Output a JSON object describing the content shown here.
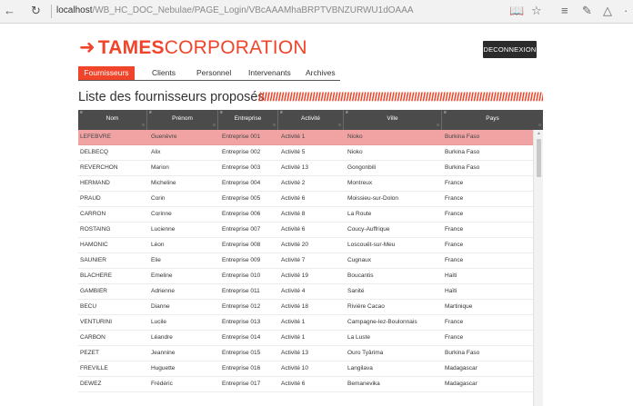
{
  "browser": {
    "back_glyph": "←",
    "refresh_glyph": "↻",
    "url_host": "localhost",
    "url_path": "/WB_HC_DOC_Nebulae/PAGE_Login/VBcAAAMhaBRPTVBNZURWU1dOAAA",
    "reading_view_glyph": "📖",
    "favorite_glyph": "☆",
    "hub_glyph": "≡",
    "note_glyph": "✎",
    "share_glyph": "△",
    "more_glyph": "·"
  },
  "header": {
    "logo_mark": "➜",
    "logo_bold": "TAMES",
    "logo_thin": "CORPORATION",
    "logout_label": "DECONNEXION"
  },
  "tabs": [
    {
      "label": "Fournisseurs",
      "active": true
    },
    {
      "label": "Clients",
      "active": false
    },
    {
      "label": "Personnel",
      "active": false
    },
    {
      "label": "Intervenants",
      "active": false
    },
    {
      "label": "Archives",
      "active": false
    }
  ],
  "page": {
    "title": "Liste des fournisseurs proposés",
    "title_decoration": "//////////////////////////////////////////////////////////////////////////////////////////////////////"
  },
  "table": {
    "columns": [
      "Nom",
      "Prénom",
      "Entreprise",
      "Activité",
      "Ville",
      "Pays"
    ],
    "header_marker": "≡",
    "sort_marker": "○",
    "selected_row": 0,
    "rows": [
      [
        "LEFEBVRE",
        "Guenèvre",
        "Entreprise 001",
        "Activité 1",
        "Nioko",
        "Burkina Faso"
      ],
      [
        "DELBECQ",
        "Alix",
        "Entreprise 002",
        "Activité 5",
        "Nioko",
        "Burkina Faso"
      ],
      [
        "REVERCHON",
        "Marion",
        "Entreprise 003",
        "Activité 13",
        "Gongonbili",
        "Burkina Faso"
      ],
      [
        "HERMAND",
        "Micheline",
        "Entreprise 004",
        "Activité 2",
        "Montreux",
        "France"
      ],
      [
        "PRAUD",
        "Corin",
        "Entreprise 005",
        "Activité 6",
        "Moissieu-sur-Dolon",
        "France"
      ],
      [
        "CARRON",
        "Corinne",
        "Entreprise 006",
        "Activité 8",
        "La Route",
        "France"
      ],
      [
        "ROSTAING",
        "Lucienne",
        "Entreprise 007",
        "Activité 6",
        "Coucy-Auffrique",
        "France"
      ],
      [
        "HAMONIC",
        "Léon",
        "Entreprise 008",
        "Activité 20",
        "Loscouët-sur-Meu",
        "France"
      ],
      [
        "SAUNIER",
        "Elie",
        "Entreprise 009",
        "Activité 7",
        "Cugnaux",
        "France"
      ],
      [
        "BLACHERE",
        "Emeline",
        "Entreprise 010",
        "Activité 19",
        "Boucantis",
        "Haïti"
      ],
      [
        "GAMBIER",
        "Adrienne",
        "Entreprise 011",
        "Activité 4",
        "Sanité",
        "Haïti"
      ],
      [
        "BECU",
        "Dianne",
        "Entreprise 012",
        "Activité 18",
        "Rivière Cacao",
        "Martinique"
      ],
      [
        "VENTURINI",
        "Lucile",
        "Entreprise 013",
        "Activité 1",
        "Campagne-lez-Boulonnais",
        "France"
      ],
      [
        "CARBON",
        "Léandre",
        "Entreprise 014",
        "Activité 1",
        "La Luste",
        "France"
      ],
      [
        "PEZET",
        "Jeannine",
        "Entreprise 015",
        "Activité 13",
        "Ouro Tyârima",
        "Burkina Faso"
      ],
      [
        "FREVILLE",
        "Huguette",
        "Entreprise 016",
        "Activité 10",
        "Langilava",
        "Madagascar"
      ],
      [
        "DEWEZ",
        "Frédéric",
        "Entreprise 017",
        "Activité 6",
        "Bemanevika",
        "Madagascar"
      ]
    ]
  },
  "colors": {
    "brand": "#f0452a",
    "header_bg": "#4b4b4b",
    "selected_row": "#f1a3a3"
  }
}
